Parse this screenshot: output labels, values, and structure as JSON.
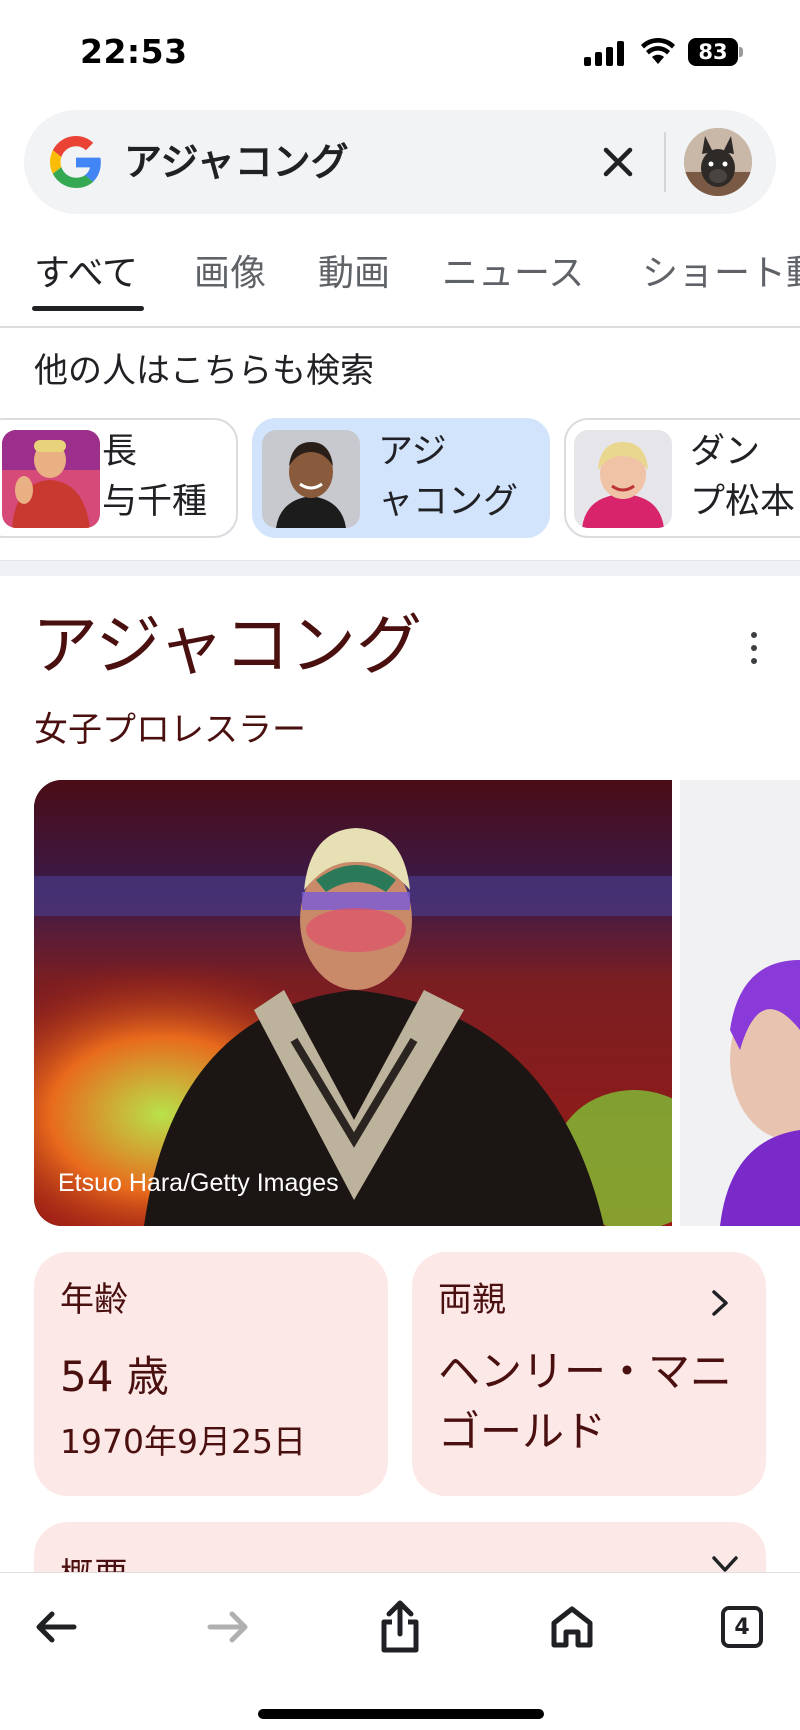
{
  "status_bar": {
    "time": "22:53",
    "battery_level": "83",
    "icons": [
      "signal-icon",
      "wifi-icon",
      "battery-icon"
    ]
  },
  "search": {
    "query": "アジャコング",
    "logo": "google-g-icon",
    "clear_icon": "close-icon"
  },
  "tabs": [
    {
      "label": "すべて",
      "active": true
    },
    {
      "label": "画像",
      "active": false
    },
    {
      "label": "動画",
      "active": false
    },
    {
      "label": "ニュース",
      "active": false
    },
    {
      "label": "ショート動",
      "active": false
    }
  ],
  "people_also_search": {
    "heading": "他の人はこちらも検索",
    "items": [
      {
        "label_line1": "長",
        "label_line2": "与千種"
      },
      {
        "label_line1": "アジ",
        "label_line2": "ャコング",
        "selected": true
      },
      {
        "label_line1": "ダン",
        "label_line2": "プ松本"
      }
    ]
  },
  "knowledge_panel": {
    "title": "アジャコング",
    "subtitle": "女子プロレスラー",
    "photo_credit": "Etsuo Hara/Getty Images",
    "cards": {
      "age": {
        "label": "年齢",
        "value": "54 歳",
        "sub": "1970年9月25日"
      },
      "parents": {
        "label": "両親",
        "value": "ヘンリー・マニゴールド"
      }
    },
    "overview": {
      "label": "概要"
    }
  },
  "toolbar": {
    "tabs_count": "4",
    "buttons": [
      "back-icon",
      "forward-icon",
      "share-icon",
      "home-icon",
      "tabs-icon"
    ]
  },
  "colors": {
    "accent_text": "#4a1010",
    "card_background": "#fce8e6",
    "chip_selected": "#d2e3fc"
  }
}
